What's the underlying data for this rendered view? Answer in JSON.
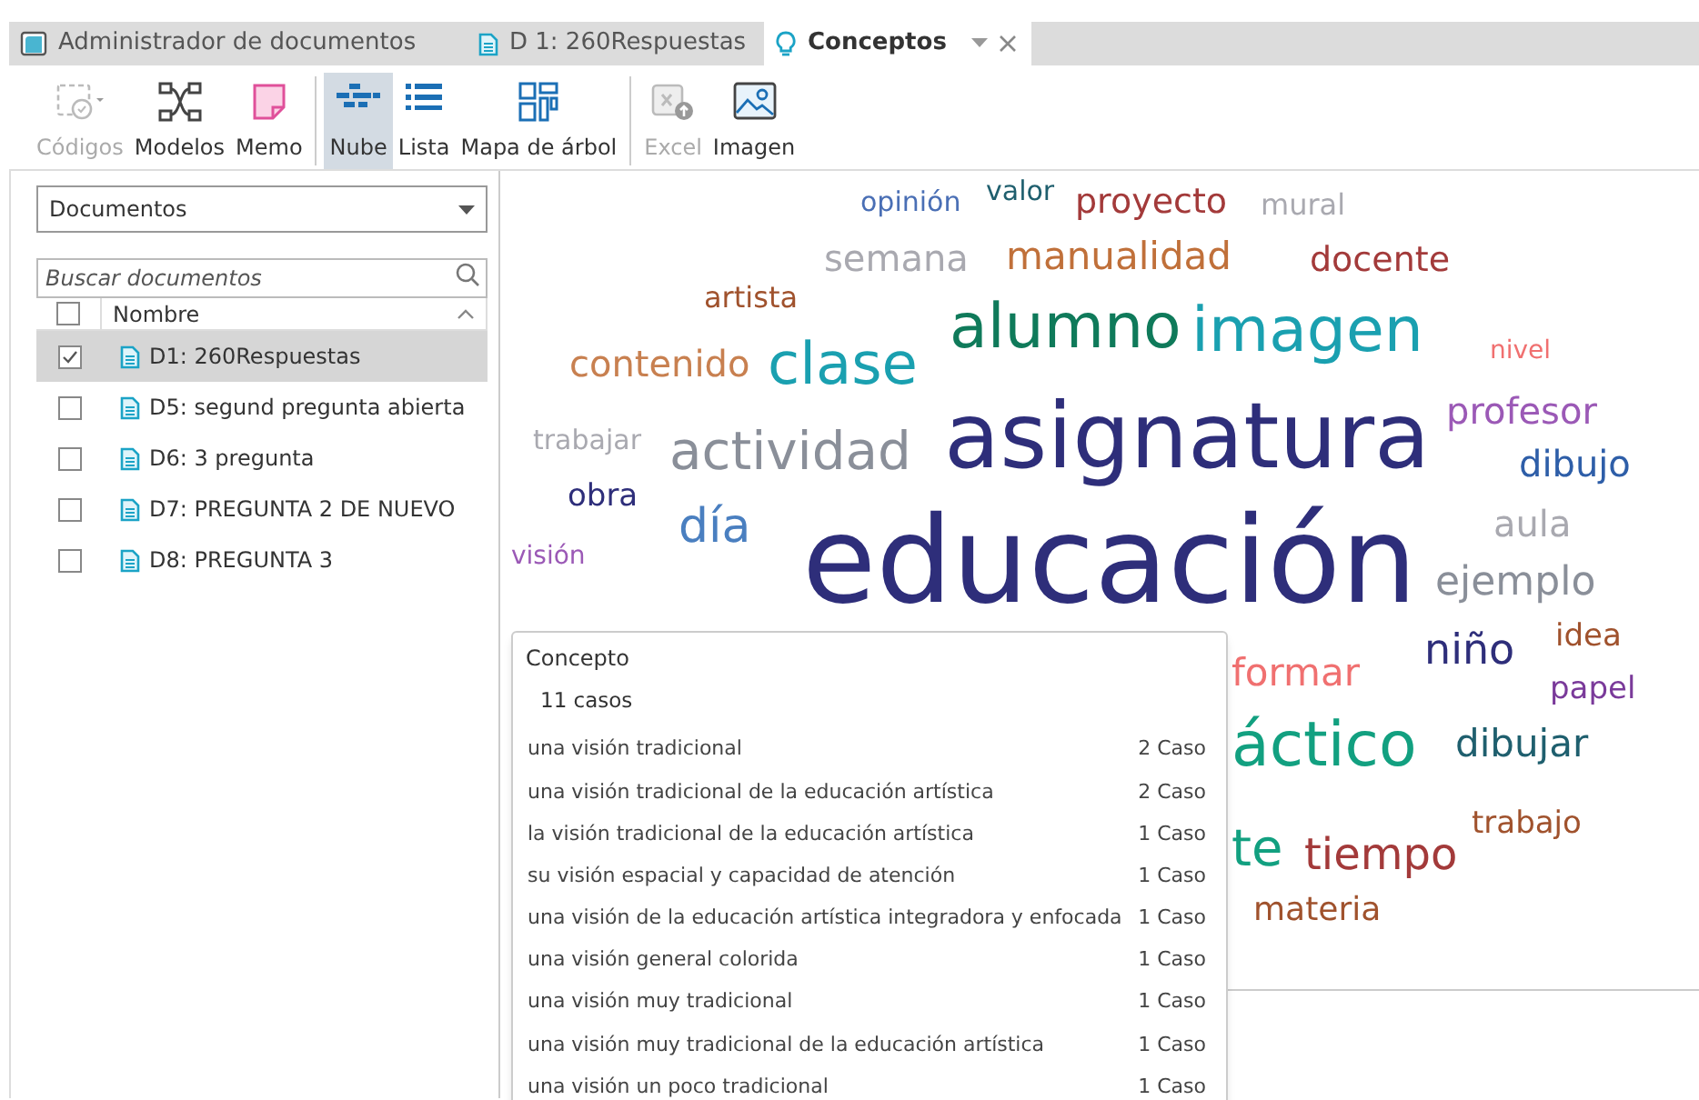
{
  "tabs": [
    {
      "label": "Administrador de documentos",
      "kind": "manager",
      "selected": false
    },
    {
      "label": "D 1: 260Respuestas",
      "kind": "document",
      "selected": false
    },
    {
      "label": "Conceptos",
      "kind": "concepts",
      "selected": true
    }
  ],
  "toolbar": [
    {
      "label": "Códigos",
      "kind": "codes",
      "disabled": true,
      "selected": false
    },
    {
      "label": "Modelos",
      "kind": "models",
      "disabled": false,
      "selected": false
    },
    {
      "label": "Memo",
      "kind": "memo",
      "disabled": false,
      "selected": false
    },
    {
      "kind": "separator"
    },
    {
      "label": "Nube",
      "kind": "cloud",
      "disabled": false,
      "selected": true
    },
    {
      "label": "Lista",
      "kind": "list",
      "disabled": false,
      "selected": false
    },
    {
      "label": "Mapa de árbol",
      "kind": "treemap",
      "disabled": false,
      "selected": false
    },
    {
      "kind": "separator"
    },
    {
      "label": "Excel",
      "kind": "excel",
      "disabled": true,
      "selected": false
    },
    {
      "label": "Imagen",
      "kind": "image",
      "disabled": false,
      "selected": false
    }
  ],
  "sidebar": {
    "dropdown": "Documentos",
    "search": {
      "placeholder": "Buscar documentos"
    },
    "column": "Nombre",
    "all_checked": false,
    "items": [
      {
        "label": "D1: 260Respuestas",
        "checked": true,
        "selected": true
      },
      {
        "label": "D5: segund pregunta abierta",
        "checked": false,
        "selected": false
      },
      {
        "label": "D6: 3 pregunta",
        "checked": false,
        "selected": false
      },
      {
        "label": "D7: PREGUNTA 2 DE NUEVO",
        "checked": false,
        "selected": false
      },
      {
        "label": "D8: PREGUNTA 3",
        "checked": false,
        "selected": false
      }
    ]
  },
  "word_cloud": [
    {
      "text": "opinión",
      "color": "#4a6fb5"
    },
    {
      "text": "valor",
      "color": "#1f5f6e"
    },
    {
      "text": "proyecto",
      "color": "#a33a3a"
    },
    {
      "text": "mural",
      "color": "#a9a9b0"
    },
    {
      "text": "semana",
      "color": "#a9a9b0"
    },
    {
      "text": "manualidad",
      "color": "#c0703a"
    },
    {
      "text": "docente",
      "color": "#a33a3a"
    },
    {
      "text": "artista",
      "color": "#a0522d"
    },
    {
      "text": "alumno",
      "color": "#0f7a5a"
    },
    {
      "text": "imagen",
      "color": "#1aa0b0"
    },
    {
      "text": "nivel",
      "color": "#f07070"
    },
    {
      "text": "contenido",
      "color": "#c88050"
    },
    {
      "text": "clase",
      "color": "#1aa0b0"
    },
    {
      "text": "trabajar",
      "color": "#a9a9b0"
    },
    {
      "text": "actividad",
      "color": "#8a8f99"
    },
    {
      "text": "asignatura",
      "color": "#2e2e7a"
    },
    {
      "text": "profesor",
      "color": "#9b59b6"
    },
    {
      "text": "dibujo",
      "color": "#2e5ea8"
    },
    {
      "text": "obra",
      "color": "#2e2e7a"
    },
    {
      "text": "día",
      "color": "#4a7fc0"
    },
    {
      "text": "aula",
      "color": "#a9a9b0"
    },
    {
      "text": "visión",
      "color": "#9b59b6"
    },
    {
      "text": "educación",
      "color": "#2e2e7a"
    },
    {
      "text": "ejemplo",
      "color": "#8a8f99"
    },
    {
      "text": "niño",
      "color": "#2e2e7a"
    },
    {
      "text": "idea",
      "color": "#a0522d"
    },
    {
      "text": "formar",
      "color": "#f07070"
    },
    {
      "text": "papel",
      "color": "#7a3a9a"
    },
    {
      "text": "áctico",
      "color": "#12a080"
    },
    {
      "text": "dibujar",
      "color": "#1f5f6e"
    },
    {
      "text": "trabajo",
      "color": "#a0522d"
    },
    {
      "text": "te",
      "color": "#12a080"
    },
    {
      "text": "tiempo",
      "color": "#a33a3a"
    },
    {
      "text": "materia",
      "color": "#a0522d"
    }
  ],
  "popup": {
    "title": "Concepto",
    "count": "11 casos",
    "rows": [
      {
        "text": "una visión tradicional",
        "count": "2 Caso"
      },
      {
        "text": "una visión tradicional de la educación artística",
        "count": "2 Caso"
      },
      {
        "text": "la visión tradicional de la educación artística",
        "count": "1 Caso"
      },
      {
        "text": "su visión espacial y capacidad de atención",
        "count": "1 Caso"
      },
      {
        "text": "una visión de la educación artística integradora y enfocada",
        "count": "1 Caso"
      },
      {
        "text": "una visión general colorida",
        "count": "1 Caso"
      },
      {
        "text": "una visión muy tradicional",
        "count": "1 Caso"
      },
      {
        "text": "una visión muy tradicional de la educación artística",
        "count": "1 Caso"
      },
      {
        "text": "una visión un poco tradicional",
        "count": "1 Caso"
      }
    ]
  }
}
